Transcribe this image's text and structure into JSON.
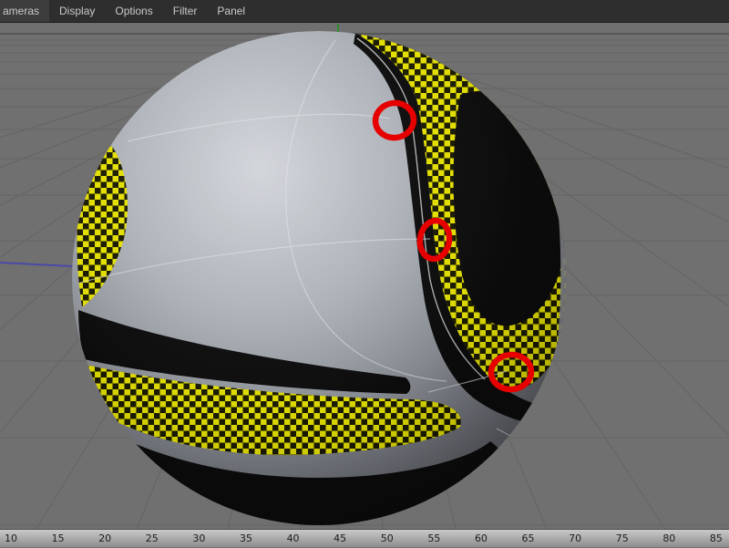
{
  "menu_bar": {
    "items": [
      "ameras",
      "Display",
      "Options",
      "Filter",
      "Panel"
    ]
  },
  "viewport": {
    "background_color": "#707070",
    "grid_color": "#646464",
    "horizon_color": "#4d4d4d",
    "axis_tick_color": "#2e8b2e",
    "axis_line_color": "#4949a8",
    "ball": {
      "base_light": "#cdd1d6",
      "base_dark": "#46484d",
      "panel_black": "#0c0c0c",
      "checker_yellow": "#e3df00",
      "checker_dark": "#1a1a00",
      "seam_color": "#dde0e4"
    },
    "annotations": {
      "color": "#e60000",
      "labels": [
        "seam-point-top",
        "seam-point-middle",
        "seam-point-bottom"
      ]
    }
  },
  "ruler": {
    "ticks": [
      "10",
      "15",
      "20",
      "25",
      "30",
      "35",
      "40",
      "45",
      "50",
      "55",
      "60",
      "65",
      "70",
      "75",
      "80",
      "85"
    ]
  }
}
